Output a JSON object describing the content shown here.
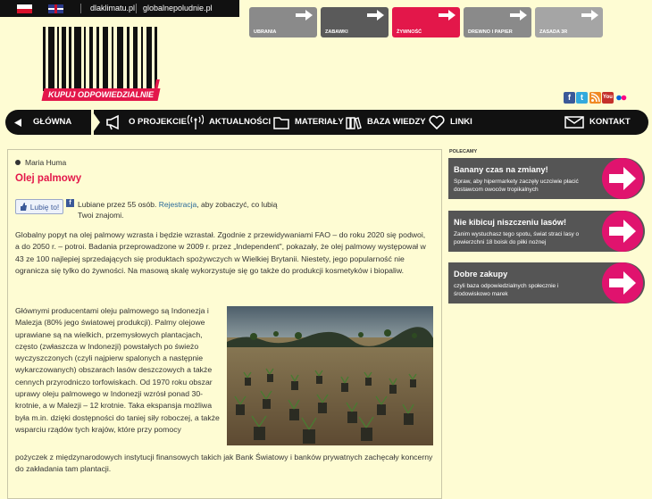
{
  "topbar": {
    "lang_pl": "Polski",
    "lang_en": "English",
    "link1": "dlaklimatu.pl",
    "link2": "globalnepoludnie.pl"
  },
  "logo": {
    "slogan": "KUPUJ ODPOWIEDZIALNIE",
    "exclamation": "!"
  },
  "categories": [
    {
      "label": "UBRANIA",
      "color": "#8a8a8a"
    },
    {
      "label": "ZABAWKI",
      "color": "#5a5a5a"
    },
    {
      "label": "ŻYWNOŚĆ",
      "color": "#e3174a"
    },
    {
      "label": "DREWNO I PAPIER",
      "color": "#8a8a8a"
    },
    {
      "label": "ZASADA 3R",
      "color": "#a5a5a5"
    }
  ],
  "social": [
    "facebook-icon",
    "twitter-icon",
    "rss-icon",
    "youtube-icon",
    "flickr-icon"
  ],
  "nav": {
    "home": "GŁÓWNA",
    "about": "O PROJEKCIE",
    "news": "AKTUALNOŚCI",
    "materials": "MATERIAŁY",
    "knowledge": "BAZA WIEDZY",
    "links": "LINKI",
    "contact": "KONTAKT"
  },
  "article": {
    "author": "Maria Huma",
    "title": "Olej palmowy",
    "like_button": "Lubię to!",
    "like_count_text": "Lubiane przez 55 osób.",
    "like_register_link": "Rejestracja",
    "like_suffix": ", aby zobaczyć, co lubią Twoi znajomi.",
    "paragraph1": "Globalny popyt na olej palmowy wzrasta i będzie wzrastał. Zgodnie z przewidywaniami FAO – do roku 2020 się podwoi, a do 2050 r. – potroi. Badania przeprowadzone w 2009 r. przez „Independent\", pokazały, że olej palmowy występował w 43 ze 100 najlepiej sprzedających się produktach spożywczych w Wielkiej Brytanii. Niestety, jego popularność nie ogranicza się tylko do żywności. Na masową skalę wykorzystuje się go także do produkcji kosmetyków i biopaliw.",
    "paragraph2": "Głównymi producentami oleju palmowego są Indonezja i Malezja (80% jego światowej produkcji). Palmy olejowe uprawiane są na wielkich, przemysłowych plantacjach, często (zwłaszcza w Indonezji) powstałych po świeżo wyczyszczonych (czyli najpierw spalonych a następnie wykarczowanych) obszarach lasów deszczowych a także cennych przyrodniczo torfowiskach. Od 1970 roku obszar uprawy oleju palmowego w Indonezji wzrósł ponad 30-krotnie, a w Malezji – 12 krotnie. Taka ekspansja możliwa była m.in. dzięki dostępności do taniej siły roboczej, a także wsparciu rządów tych krajów, które przy pomocy",
    "paragraph3": "pożyczek z międzynarodowych instytucji finansowych takich jak Bank Światowy i banków prywatnych zachęcały koncerny do zakładania tam plantacji."
  },
  "sidebar": {
    "heading": "POLECAMY",
    "promos": [
      {
        "title": "Banany czas na zmiany!",
        "desc": "Spraw, aby hipermarkety zaczęły uczciwie płacić dostawcom owoców tropikalnych"
      },
      {
        "title": "Nie kibicuj niszczeniu lasów!",
        "desc": "Zanim wystuchasz tego spotu, świat straci lasy o powierzchni 18 boisk do piłki nożnej"
      },
      {
        "title": "Dobre zakupy",
        "desc": "czyli baza odpowiedzialnych społecznie i środowiskowo marek"
      }
    ]
  }
}
